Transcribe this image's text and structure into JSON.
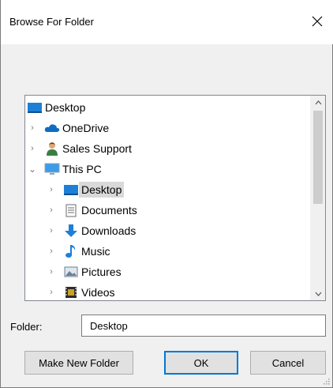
{
  "window": {
    "title": "Browse For Folder",
    "close_icon": "close-icon"
  },
  "tree": {
    "items": [
      {
        "label": "Desktop",
        "icon": "desktop-icon",
        "expander": "",
        "selected": false
      },
      {
        "label": "OneDrive",
        "icon": "onedrive-cloud-icon",
        "expander": "collapsed",
        "selected": false
      },
      {
        "label": "Sales Support",
        "icon": "user-icon",
        "expander": "collapsed",
        "selected": false
      },
      {
        "label": "This PC",
        "icon": "computer-icon",
        "expander": "expanded",
        "selected": false
      },
      {
        "label": "Desktop",
        "icon": "desktop-icon",
        "expander": "collapsed",
        "selected": true
      },
      {
        "label": "Documents",
        "icon": "document-icon",
        "expander": "collapsed",
        "selected": false
      },
      {
        "label": "Downloads",
        "icon": "download-arrow-icon",
        "expander": "collapsed",
        "selected": false
      },
      {
        "label": "Music",
        "icon": "music-note-icon",
        "expander": "collapsed",
        "selected": false
      },
      {
        "label": "Pictures",
        "icon": "pictures-icon",
        "expander": "collapsed",
        "selected": false
      },
      {
        "label": "Videos",
        "icon": "videos-film-icon",
        "expander": "collapsed",
        "selected": false
      }
    ]
  },
  "folder": {
    "label": "Folder:",
    "value": "Desktop"
  },
  "buttons": {
    "make_new": "Make New Folder",
    "ok": "OK",
    "cancel": "Cancel"
  },
  "colors": {
    "selection": "#d9d9d9",
    "default_button_border": "#0078d7",
    "desktop_blue": "#1e7fd6"
  }
}
